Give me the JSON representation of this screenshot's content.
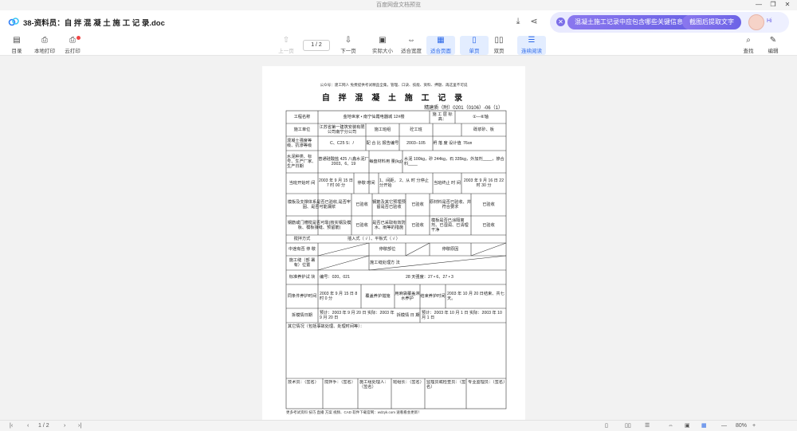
{
  "window": {
    "title": "百度网盘文档预览"
  },
  "doc": {
    "title": "38-资料员：自 拌 混 凝 土 施 工 记 录.doc"
  },
  "ai": {
    "question": "混凝土施工记录中应包含哪些关键信息?",
    "action": "截图后提取文字",
    "greet": "Hi"
  },
  "toolbar": {
    "catalog": "目录",
    "local_print": "本地打印",
    "cloud_print": "云打印",
    "prev": "上一页",
    "page": "1 / 2",
    "next": "下一页",
    "actual": "实际大小",
    "fit_width": "适合宽度",
    "fit_page": "适合页面",
    "single": "单页",
    "double": "双页",
    "continuous": "连续阅读",
    "find": "查找",
    "edit": "编辑"
  },
  "page": {
    "note": "公众号：建工网人 免费提供考试精品全集，管理、口诀、技能、资料、押题、再这里不可说",
    "title": "自 拌 混 凝 土 施 工 记 录",
    "num": "精建质（附）0201（0106）-06（1）",
    "cells": {
      "r1a": "工程名称",
      "r1b": "金地世家 • 南宁仙霞电器城 12#楼",
      "r1c": "施 工 层 标 高：",
      "r1d": "①—⑥轴",
      "r2a": "施工单位",
      "r2b": "江苏省第一建筑安装有限公司南宁分公司",
      "r2c": "施工班组",
      "r2d": "砼工班",
      "r2e": "砾浆砂、板",
      "r3a": "混凝土强度等级、抗渗等级",
      "r3b": "C、C25 S：/",
      "r3c": "配 合 比 报告编号",
      "r3d": "2003--105",
      "r3e": "坍 落 度 设计值",
      "r3f": "76㎝",
      "r4a": "水泥种类、标号、生产厂家、生产日期",
      "r4b": "普通硅酸盐 425 八鑫水泥厂 2003、6、19",
      "r4c": "每盘材料用 量(kg)",
      "r4d": "水泥 100kg，砂 244kg，石 335kg，外加剂____，掺合料____",
      "r5a": "当班开始时 间",
      "r5b": "2003 年 9 月 15 日 7 时 00 分",
      "r5c": "停歇 时间",
      "r5d": "1、间距， 2、从 时 分停止 分开始",
      "r5e": "当班终止 时 间",
      "r5f": "2003 年 9 月 16 日 22 时 30 分",
      "r6a": "模板及支撑体系是否已验收,是否牢固、是否可能漏浆",
      "r6b": "已验收",
      "r6c": "钢筋及其它预埋预留是否已验收",
      "r6d": "已验收",
      "r6e": "原材料是否已验收、并符合要求",
      "r6f": "已验收",
      "r7a": "钢筋或门槽搅是否可靠(核实钢及模板、模板接缝、预留筋)",
      "r7b": "已验收",
      "r7c": "是否已采取有效防水、雨等的措施",
      "r7d": "已验收",
      "r7e": "模板是否已涂隔离剂、已湿润、已清理干净",
      "r7f": "已验收",
      "r8a": "搅拌方式",
      "r8b": "插入式（ √ ）、平板式（ √ ）",
      "r9a": "中途有否 停 歇",
      "r9b": "停歇部位",
      "r9c": "停歇原因",
      "r10a": "施工缝（部 署有）位置",
      "r10b": "施工缝处理方 法",
      "r11a": "标准养护试 块",
      "r11b": "编号：020、021",
      "r11c": "28 天强度：27 • 6、27 • 3",
      "r12a": "同条件养护时间",
      "r12b": "2003 年 9 月 15 日 8 时 0 分",
      "r12c": "覆盖养护措施",
      "r12d": "用麻袋覆盖淋水养护",
      "r12e": "结束养护时间",
      "r12f": "2003 年 10 月 20 日结束、共七天。",
      "r13a": "拆模情日期",
      "r13b": "预计：2003 年 9 月 20 日 实际：2003 年 9 月 20 日",
      "r13c": "拆模情 日 期",
      "r13d": "预计：2003 年 10 月 1 日 实际：2003 年 10 月 1 日",
      "r14a": "其它情况（包括事故处理、处理时间等）：",
      "s1": "技术员：（签名）",
      "s2": "搅拌手：（签名）",
      "s3": "施工组处理人：（签名）",
      "s4": "班组长：（签名）",
      "s5": "监理员或检查员：（签名）",
      "s6": "专业监理员：（签名）"
    },
    "foot": "更多考试资料 技巧 直播 方案 视频、CAD 软件下载官网：wdzyk.com 速看看会更新！"
  },
  "status": {
    "page": "1 / 2",
    "zoom": "80%"
  }
}
